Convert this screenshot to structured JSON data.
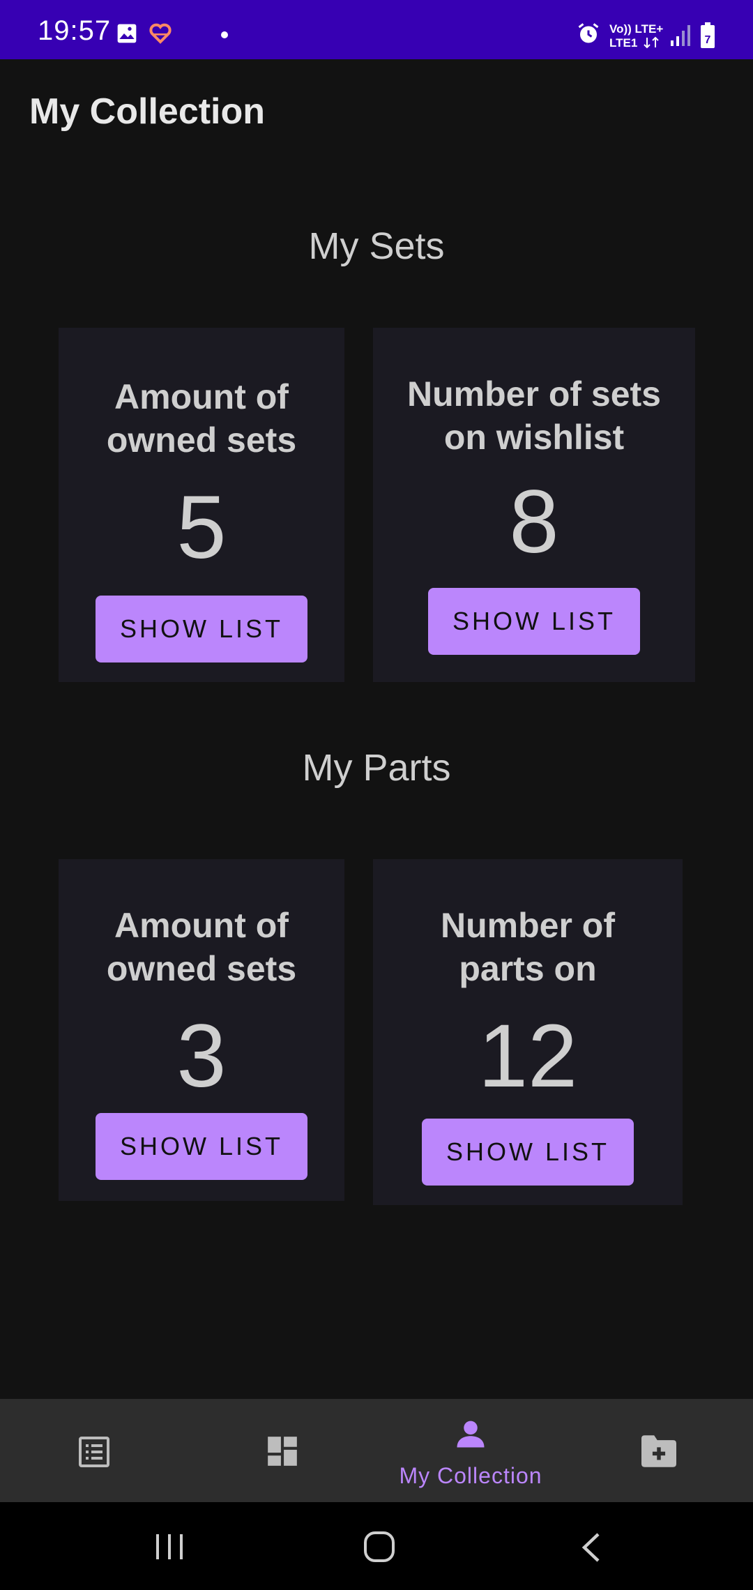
{
  "status_bar": {
    "time": "19:57",
    "network_label_top": "Vo)) LTE+",
    "network_label_bottom": "LTE1",
    "battery_level": "7"
  },
  "app": {
    "title": "My Collection"
  },
  "sets_section": {
    "title": "My Sets",
    "cards": [
      {
        "label_line1": "Amount of",
        "label_line2": "owned sets",
        "value": "5",
        "button": "SHOW LIST"
      },
      {
        "label_line1": "Number of sets",
        "label_line2": "on wishlist",
        "value": "8",
        "button": "SHOW LIST"
      }
    ]
  },
  "parts_section": {
    "title": "My Parts",
    "cards": [
      {
        "label_line1": "Amount of",
        "label_line2": "owned sets",
        "value": "3",
        "button": "SHOW LIST"
      },
      {
        "label_line1": "Number of",
        "label_line2": "parts on",
        "value": "12",
        "button": "SHOW LIST"
      }
    ]
  },
  "bottom_nav": {
    "items": [
      {
        "icon": "list-icon",
        "label": ""
      },
      {
        "icon": "dashboard-icon",
        "label": ""
      },
      {
        "icon": "person-icon",
        "label": "My Collection",
        "selected": true
      },
      {
        "icon": "folder-add-icon",
        "label": ""
      }
    ]
  },
  "colors": {
    "status_bar": "#3700b3",
    "background": "#121212",
    "card": "#1b1a22",
    "accent": "#bb86fc",
    "nav_bg": "#2d2d2d"
  }
}
